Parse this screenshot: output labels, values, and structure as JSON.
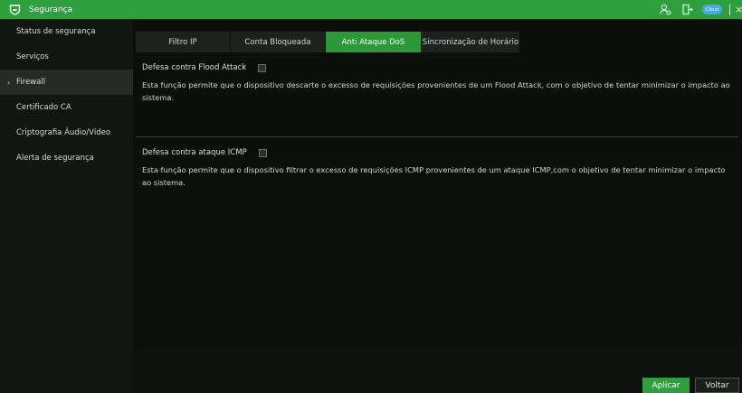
{
  "window": {
    "title": "Segurança",
    "cloud_label": "Cloud",
    "close_glyph": "×",
    "icons": [
      "shield-icon",
      "user-icon",
      "exit-icon",
      "cloud-icon",
      "close-icon"
    ]
  },
  "sidebar": {
    "items": [
      {
        "label": "Status de segurança",
        "active": false
      },
      {
        "label": "Serviços",
        "active": false
      },
      {
        "label": "Firewall",
        "active": true,
        "caret": "›"
      },
      {
        "label": "Certificado CA",
        "active": false
      },
      {
        "label": "Criptografia Áudio/Vídeo",
        "active": false
      },
      {
        "label": "Alerta de segurança",
        "active": false
      }
    ]
  },
  "tabs": [
    {
      "label": "Filtro IP",
      "active": false
    },
    {
      "label": "Conta Bloqueada",
      "active": false
    },
    {
      "label": "Anti Ataque DoS",
      "active": true
    },
    {
      "label": "Sincronização de Horário",
      "active": false
    }
  ],
  "flood": {
    "label": "Defesa contra Flood Attack",
    "checked": false,
    "description": "Esta função permite que o dispositivo descarte o excesso de requisições provenientes de um Flood Attack, com o objetivo de tentar minimizar o impacto ao sistema."
  },
  "icmp": {
    "label": "Defesa contra ataque ICMP",
    "checked": false,
    "description": "Esta função permite que o dispositivo filtrar o excesso de requisições ICMP provenientes de um ataque ICMP,com o objetivo de tentar minimizar o impacto ao sistema."
  },
  "buttons": {
    "apply": "Aplicar",
    "back": "Voltar"
  },
  "colors": {
    "accent": "#2e9f3d",
    "background": "#0d0f0d",
    "sidebar_active": "#262b26"
  }
}
